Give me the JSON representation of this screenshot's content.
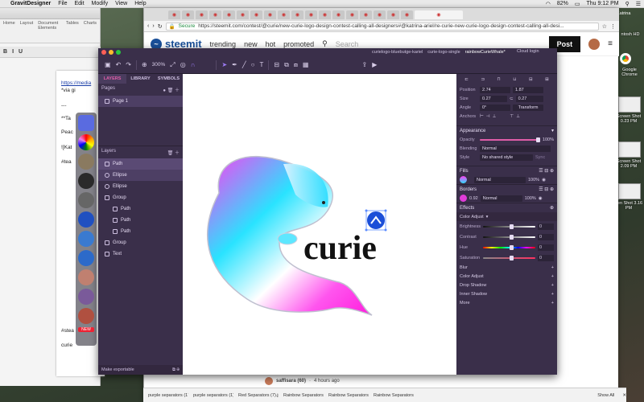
{
  "menubar": {
    "app": "GravitDesigner",
    "items": [
      "File",
      "Edit",
      "Modify",
      "View",
      "Help"
    ],
    "battery": "82%",
    "clock": "Thu 9:12 PM",
    "user": "Katrina"
  },
  "word": {
    "menu": [
      "Home",
      "Layout",
      "Document Elements",
      "Tables",
      "Charts"
    ],
    "lines": [
      {
        "t": "https://media",
        "link": true
      },
      {
        "t": "*via gi",
        "link": false
      },
      {
        "t": "---",
        "link": false
      },
      {
        "t": "**Ta",
        "link": false
      },
      {
        "t": "Peac",
        "link": false
      },
      {
        "t": "![Kat",
        "link": false
      },
      {
        "t": "#tea",
        "link": false
      },
      {
        "t": "#stea",
        "link": false
      },
      {
        "t": "curie",
        "link": false
      }
    ]
  },
  "browser": {
    "url_secure": "Secure",
    "url": "https://steemit.com/contest/@curie/new-curie-logo-design-contest-calling-all-designers#@katrina-ariel/re-curie-new-curie-logo-design-contest-calling-all-desi...",
    "steemit_logo": "steemit",
    "nav": [
      "trending",
      "new",
      "hot",
      "promoted"
    ],
    "search_placeholder": "Search",
    "post_label": "Post",
    "comment_user": "saffisara (60)",
    "comment_time": "4 hours ago"
  },
  "gravit": {
    "tabs": [
      "curielogo-bluebutge-kariel",
      "curie-logo-single",
      "rainbowCurieWhale*"
    ],
    "cloud": "Cloud login",
    "zoom": "300%",
    "left_tabs": [
      "LAYERS",
      "LIBRARY",
      "SYMBOLS"
    ],
    "pages_label": "Pages",
    "page1": "Page 1",
    "layers_label": "Layers",
    "layers": [
      {
        "name": "Path",
        "indent": 0,
        "sel": "sel",
        "circ": false
      },
      {
        "name": "Ellipse",
        "indent": 0,
        "sel": "sel2",
        "circ": true
      },
      {
        "name": "Ellipse",
        "indent": 0,
        "sel": "",
        "circ": true
      },
      {
        "name": "Group",
        "indent": 0,
        "sel": "",
        "circ": false
      },
      {
        "name": "Path",
        "indent": 1,
        "sel": "",
        "circ": false
      },
      {
        "name": "Path",
        "indent": 1,
        "sel": "",
        "circ": false
      },
      {
        "name": "Path",
        "indent": 1,
        "sel": "",
        "circ": false
      },
      {
        "name": "Group",
        "indent": 0,
        "sel": "",
        "circ": false
      },
      {
        "name": "Text",
        "indent": 0,
        "sel": "",
        "circ": false
      }
    ],
    "make_exportable": "Make exportable",
    "artwork_text": "curie",
    "right": {
      "position_label": "Position",
      "x": "2.74",
      "y": "1.87",
      "size_label": "Size",
      "w": "0.27",
      "h": "0.27",
      "angle_label": "Angle",
      "angle": "0°",
      "transform_label": "Transform",
      "anchors_label": "Anchors",
      "appearance": "Appearance",
      "opacity_label": "Opacity",
      "opacity_val": "100%",
      "blending_label": "Blending",
      "blending_val": "Normal",
      "style_label": "Style",
      "style_val": "No shared style",
      "sync": "Sync",
      "fills": "Fills",
      "fill_mode": "Normal",
      "fill_pct": "100%",
      "borders": "Borders",
      "border_w": "0.92",
      "border_mode": "Normal",
      "border_pct": "100%",
      "effects": "Effects",
      "color_adjust": "Color Adjust",
      "adjust_rows": [
        {
          "label": "Brightness",
          "val": "0",
          "kind": "plain"
        },
        {
          "label": "Contrast",
          "val": "0",
          "kind": "plain"
        },
        {
          "label": "Hue",
          "val": "0",
          "kind": "hue"
        },
        {
          "label": "Saturation",
          "val": "0",
          "kind": "sat"
        }
      ],
      "effect_items": [
        "Blur",
        "Color Adjust",
        "Drop Shadow",
        "Inner Shadow",
        "More"
      ]
    }
  },
  "desktop_icons": [
    {
      "label": "ntosh HD"
    },
    {
      "label": "Google Chrome"
    },
    {
      "label": "Screen Shot 0.23 PM"
    },
    {
      "label": "Screen Shot 2.09 PM"
    },
    {
      "label": "een Shot 3.16 PM"
    }
  ],
  "dock": {
    "badge_new": "NEW"
  },
  "downloads": {
    "items": [
      "purple separators (17).jpg",
      "purple separators (1).gif",
      "Red Separators (7).jpg",
      "Rainbow Separators (18).jpg",
      "Rainbow Separators (1).gif",
      "Rainbow Separators (6).jpg"
    ],
    "show_all": "Show All"
  }
}
